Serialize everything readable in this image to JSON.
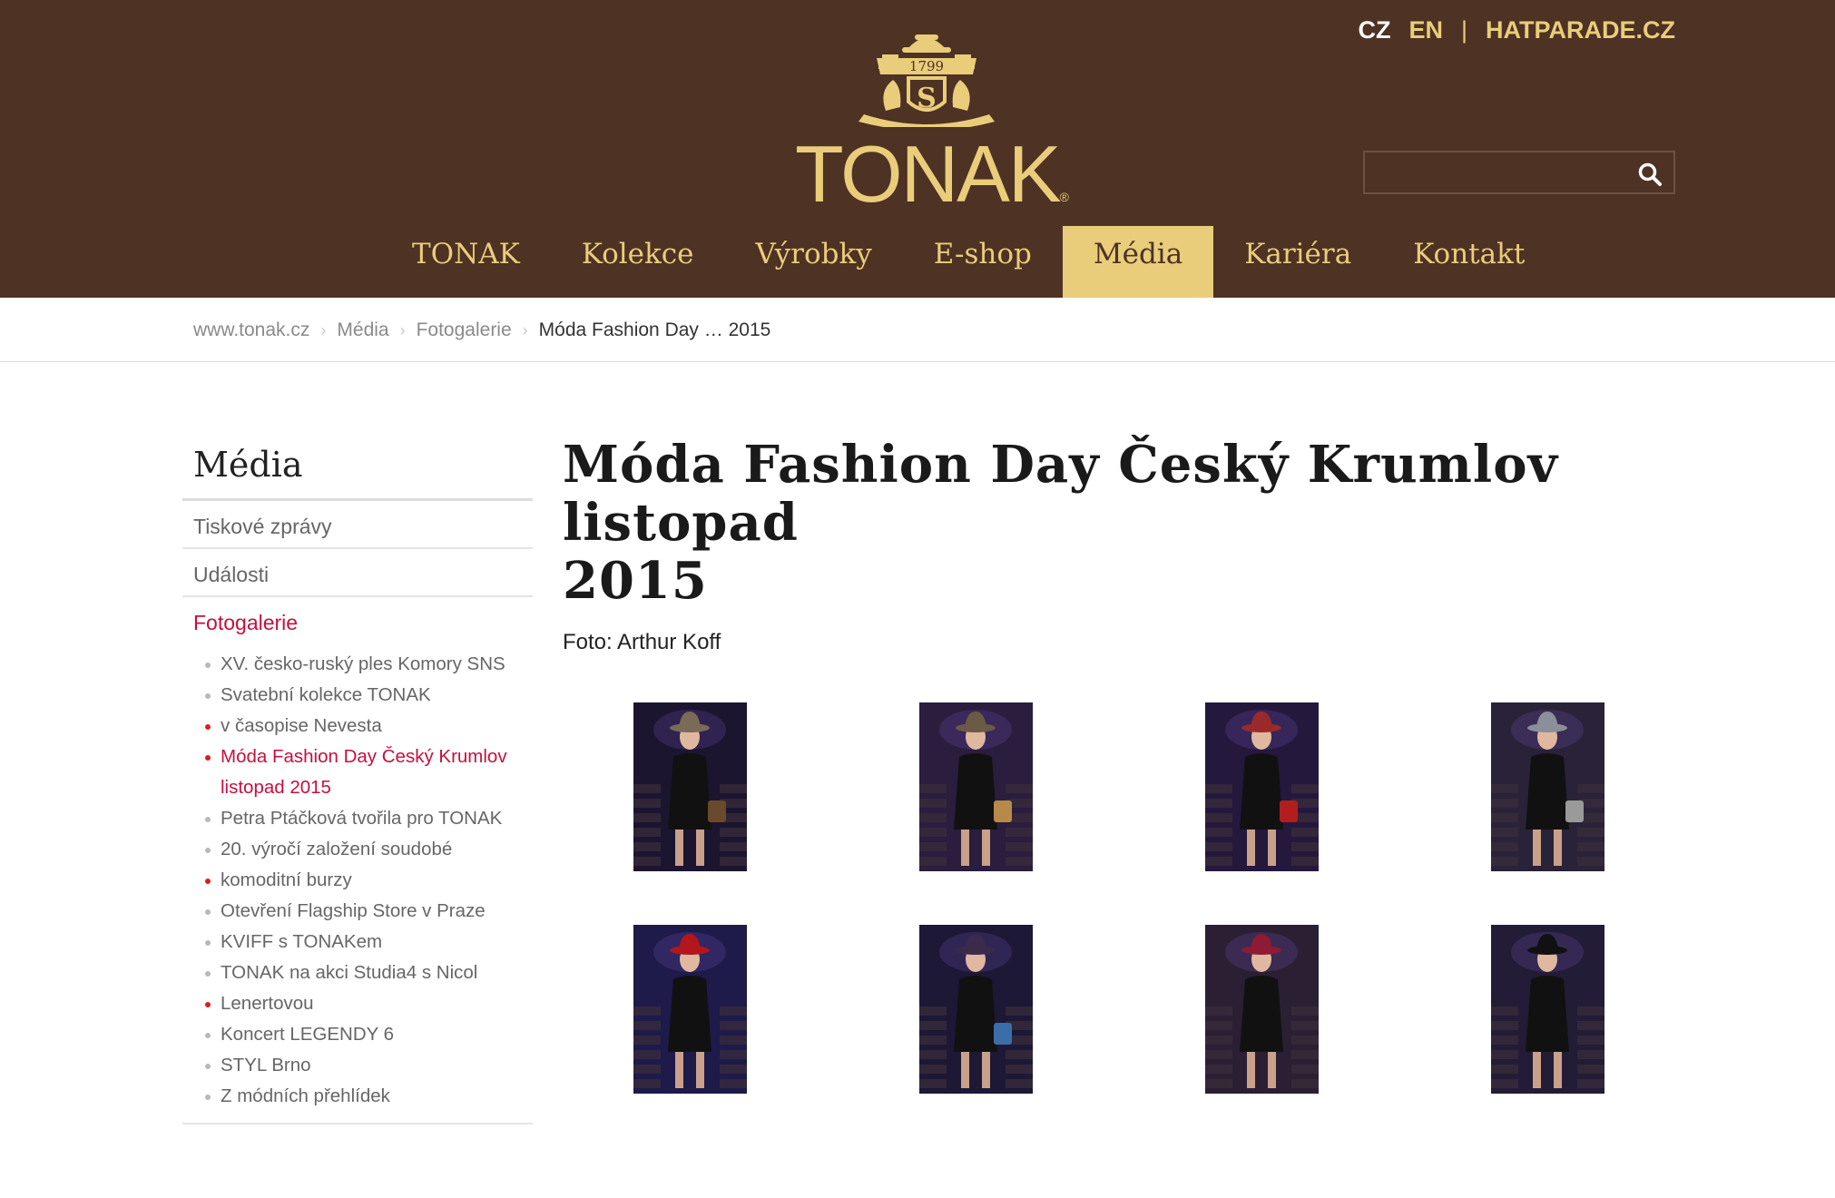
{
  "header": {
    "lang": {
      "cz": "CZ",
      "en": "EN",
      "separator": "|",
      "hatparade": "HATPARADE.CZ"
    },
    "logo": {
      "year": "1799",
      "name": "TONAK",
      "registered": "®"
    },
    "search": {
      "placeholder": ""
    },
    "nav": [
      {
        "label": "TONAK"
      },
      {
        "label": "Kolekce"
      },
      {
        "label": "Výrobky"
      },
      {
        "label": "E-shop"
      },
      {
        "label": "Média",
        "active": true
      },
      {
        "label": "Kariéra"
      },
      {
        "label": "Kontakt"
      }
    ]
  },
  "breadcrumb": {
    "items": [
      "www.tonak.cz",
      "Média",
      "Fotogalerie"
    ],
    "current": "Móda Fashion Day … 2015"
  },
  "sidebar": {
    "title": "Média",
    "links": [
      "Tiskové zprávy",
      "Události",
      "Fotogalerie"
    ],
    "subitems": [
      "XV. česko-ruský ples Komory SNS",
      "Svatební kolekce TONAK",
      "v časopise Nevesta",
      "Móda Fashion Day Český Krumlov listopad 2015",
      "Petra Ptáčková tvořila pro TONAK",
      "20. výročí založení soudobé",
      "komoditní burzy",
      "Otevření Flagship Store v Praze",
      "KVIFF s TONAKem",
      "TONAK na akci Studia4 s Nicol",
      "Lenertovou",
      "Koncert LEGENDY 6",
      "STYL Brno",
      "Z módních přehlídek"
    ]
  },
  "main": {
    "title_line1": "Móda Fashion Day Český Krumlov listopad",
    "title_line2": "2015",
    "photo_credit": "Foto: Arthur Koff"
  },
  "colors": {
    "header_bg": "#4e3224",
    "gold": "#e9cd7a",
    "active_link": "#c6103e",
    "bullet_red": "#e31a1a"
  },
  "gallery": [
    {
      "hat": "#7a6a58",
      "bg": "#1c1530",
      "accessory": "brown-bag"
    },
    {
      "hat": "#6b5a44",
      "bg": "#2a1d3e",
      "accessory": "leopard-bag"
    },
    {
      "hat": "#9a2a2a",
      "bg": "#25183d",
      "accessory": "red-bag"
    },
    {
      "hat": "#8a8f9a",
      "bg": "#2a2238",
      "accessory": "grey-bag"
    },
    {
      "hat": "#b3171d",
      "bg": "#1e1a4a",
      "accessory": "none"
    },
    {
      "hat": "#3c2a4a",
      "bg": "#1d1836",
      "accessory": "blue-bag"
    },
    {
      "hat": "#8e1a34",
      "bg": "#2b1f33",
      "accessory": "none"
    },
    {
      "hat": "#111111",
      "bg": "#231c36",
      "accessory": "none"
    }
  ]
}
